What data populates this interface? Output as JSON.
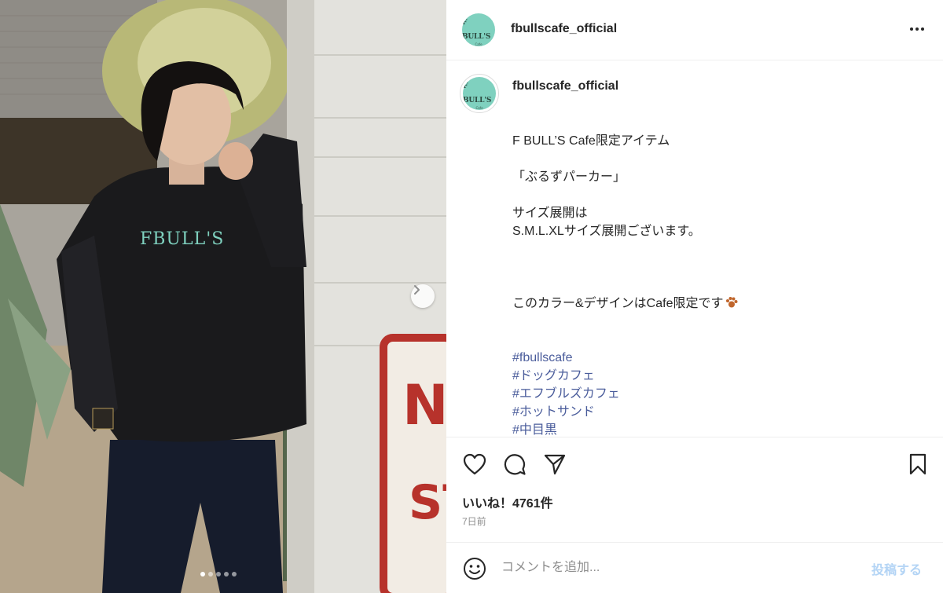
{
  "header": {
    "username": "fbullscafe_official",
    "avatar_text": "F BULL'S",
    "avatar_subtext": "Cafe"
  },
  "photo": {
    "sign_text": "N",
    "sign_text2": "ST",
    "hoodie_print": "FBULL'S",
    "slide_count": 5,
    "active_slide": 1
  },
  "caption": {
    "username": "fbullscafe_official",
    "lines": [
      "F BULL’S Cafe限定アイテム",
      "「ぶるずパーカー」",
      "サイズ展開は",
      "S.M.L.XLサイズ展開ございます。",
      "このカラー&デザインはCafe限定です"
    ],
    "hashtags": [
      "#fbullscafe",
      "#ドッグカフェ",
      "#エフブルズカフェ",
      "#ホットサンド",
      "#中目黒"
    ]
  },
  "actions": {
    "likes_label": "いいね！4761件",
    "time_label": "7日前"
  },
  "comment": {
    "placeholder": "コメントを追加...",
    "post_label": "投稿する"
  },
  "colors": {
    "avatar_bg": "#7fd1bf",
    "hashtag": "#4a5c9b",
    "post_button_disabled": "#b3d4f5"
  },
  "icons": [
    "more-options-icon",
    "chevron-right-icon",
    "heart-icon",
    "comment-icon",
    "share-icon",
    "bookmark-icon",
    "emoji-icon",
    "paw-icon"
  ]
}
